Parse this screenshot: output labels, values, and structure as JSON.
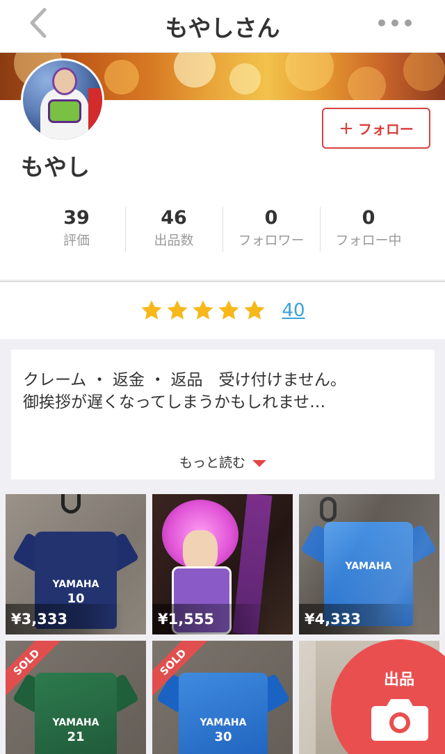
{
  "header": {
    "title": "もやしさん"
  },
  "profile": {
    "name": "もやし",
    "follow_label": "フォロー",
    "stats": [
      {
        "num": "39",
        "label": "評価"
      },
      {
        "num": "46",
        "label": "出品数"
      },
      {
        "num": "0",
        "label": "フォロワー"
      },
      {
        "num": "0",
        "label": "フォロー中"
      }
    ]
  },
  "rating": {
    "stars": 5,
    "count": "40",
    "star_color": "#f7b81b"
  },
  "description": {
    "line1": "クレーム ・ 返金 ・ 返品　受け付けません。",
    "line2": "御挨拶が遅くなってしまうかもしれませ…",
    "read_more": "もっと読む"
  },
  "items": [
    {
      "price": "¥3,333",
      "sold": false
    },
    {
      "price": "¥1,555",
      "sold": false
    },
    {
      "price": "¥4,333",
      "sold": false
    },
    {
      "price": "",
      "sold": true,
      "sold_label": "SOLD"
    },
    {
      "price": "",
      "sold": true,
      "sold_label": "SOLD"
    },
    {
      "price": "",
      "sold": false
    }
  ],
  "fab": {
    "label": "出品"
  },
  "colors": {
    "accent": "#d93f3f",
    "link": "#3aa0d8"
  }
}
